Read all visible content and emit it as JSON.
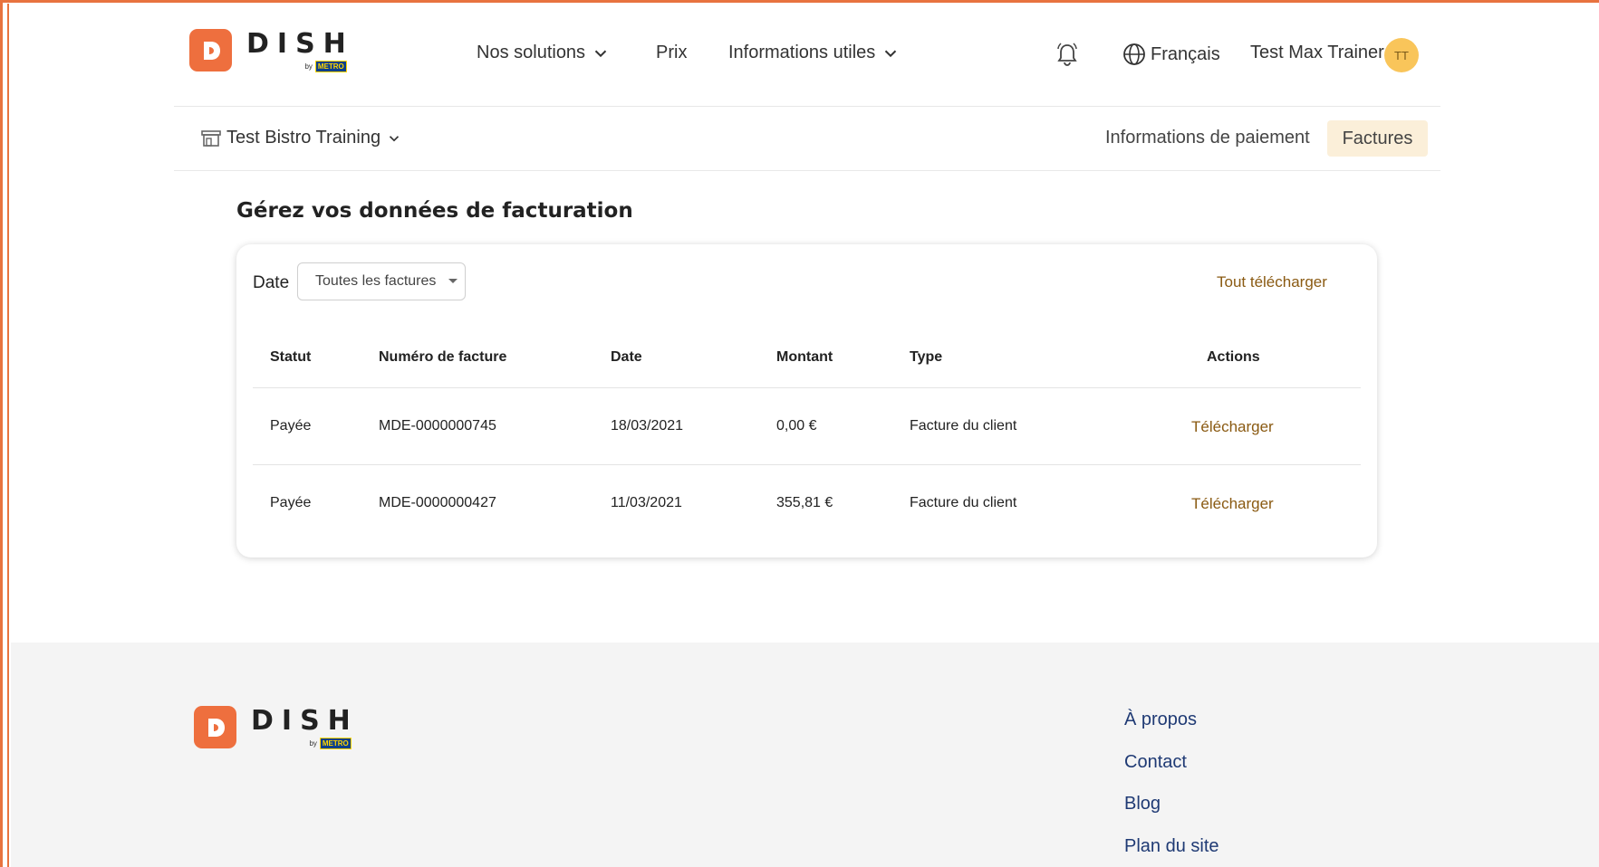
{
  "brand": {
    "name": "DISH",
    "by": "by",
    "metro": "METRO",
    "mark_color": "#ee6f3e"
  },
  "header": {
    "nav": [
      {
        "label": "Nos solutions",
        "has_dropdown": true
      },
      {
        "label": "Prix",
        "has_dropdown": false
      },
      {
        "label": "Informations utiles",
        "has_dropdown": true
      }
    ],
    "notifications_icon": "bell-icon",
    "language": "Français",
    "language_icon": "globe-icon",
    "user_name": "Test Max Trainer",
    "avatar_initials": "TT"
  },
  "subnav": {
    "establishment": "Test Bistro Training",
    "links": [
      {
        "label": "Informations de paiement",
        "active": false
      },
      {
        "label": "Factures",
        "active": true
      }
    ]
  },
  "main": {
    "title": "Gérez vos données de facturation",
    "filter": {
      "label": "Date",
      "selected": "Toutes les factures"
    },
    "download_all": "Tout télécharger",
    "table": {
      "columns": [
        "Statut",
        "Numéro de facture",
        "Date",
        "Montant",
        "Type",
        "Actions"
      ],
      "rows": [
        {
          "status": "Payée",
          "number": "MDE-0000000745",
          "date": "18/03/2021",
          "amount": "0,00 €",
          "type": "Facture du client",
          "action": "Télécharger"
        },
        {
          "status": "Payée",
          "number": "MDE-0000000427",
          "date": "11/03/2021",
          "amount": "355,81 €",
          "type": "Facture du client",
          "action": "Télécharger"
        }
      ]
    }
  },
  "footer": {
    "links": [
      "À propos",
      "Contact",
      "Blog",
      "Plan du site"
    ]
  },
  "colors": {
    "accent": "#e8733f",
    "link_brown": "#8a5a12",
    "footer_link": "#1f3a74",
    "active_tab_bg": "#fbefd9",
    "avatar_bg": "#f9c55a"
  }
}
